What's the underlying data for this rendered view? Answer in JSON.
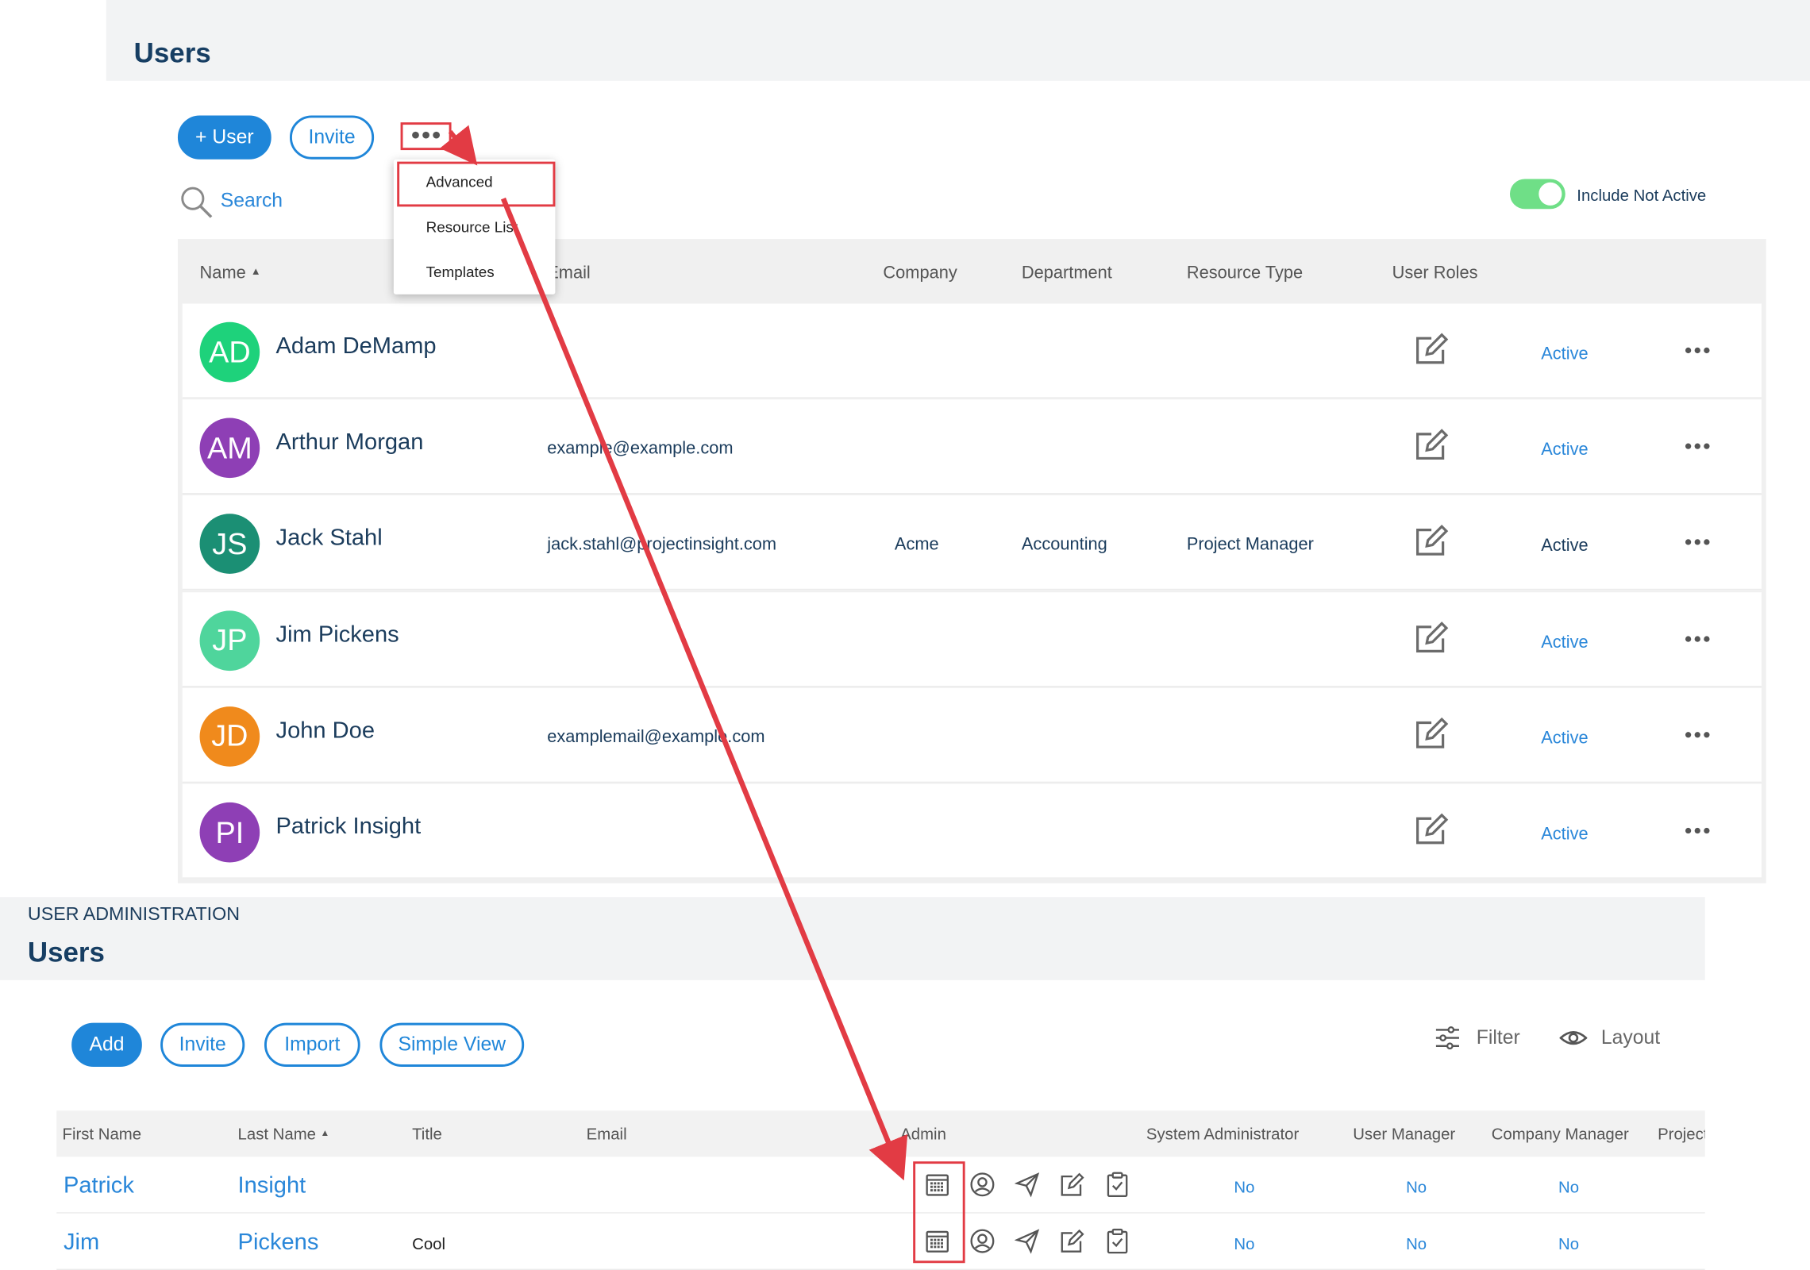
{
  "top": {
    "title": "Users",
    "add_user_label": "+ User",
    "invite_label": "Invite",
    "search_label": "Search",
    "include_not_active_label": "Include Not Active",
    "include_not_active_on": true,
    "menu_items": [
      "Advanced",
      "Resource List",
      "Templates"
    ],
    "columns": [
      "Name",
      "Email",
      "Company",
      "Department",
      "Resource Type",
      "User Roles"
    ],
    "rows": [
      {
        "initials": "AD",
        "name": "Adam DeMamp",
        "email": "",
        "company": "",
        "department": "",
        "resource_type": "",
        "status": "Active",
        "color": "#1ed27b"
      },
      {
        "initials": "AM",
        "name": "Arthur Morgan",
        "email": "example@example.com",
        "company": "",
        "department": "",
        "resource_type": "",
        "status": "Active",
        "color": "#8e3fb5"
      },
      {
        "initials": "JS",
        "name": "Jack Stahl",
        "email": "jack.stahl@projectinsight.com",
        "company": "Acme",
        "department": "Accounting",
        "resource_type": "Project Manager",
        "status": "Active",
        "color": "#1b8f74"
      },
      {
        "initials": "JP",
        "name": "Jim Pickens",
        "email": "",
        "company": "",
        "department": "",
        "resource_type": "",
        "status": "Active",
        "color": "#4fd59c"
      },
      {
        "initials": "JD",
        "name": "John Doe",
        "email": "examplemail@example.com",
        "company": "",
        "department": "",
        "resource_type": "",
        "status": "Active",
        "color": "#f08a1c"
      },
      {
        "initials": "PI",
        "name": "Patrick Insight",
        "email": "",
        "company": "",
        "department": "",
        "resource_type": "",
        "status": "Active",
        "color": "#8e3fb5"
      }
    ]
  },
  "bottom": {
    "breadcrumb": "USER ADMINISTRATION",
    "title": "Users",
    "buttons": [
      "Add",
      "Invite",
      "Import",
      "Simple View"
    ],
    "filter_label": "Filter",
    "layout_label": "Layout",
    "columns": [
      "First Name",
      "Last Name",
      "Title",
      "Email",
      "Admin",
      "System Administrator",
      "User Manager",
      "Company Manager",
      "Project"
    ],
    "rows": [
      {
        "first": "Patrick",
        "last": "Insight",
        "title": "",
        "email": "",
        "sys_admin": "No",
        "user_manager": "No",
        "company_manager": "No"
      },
      {
        "first": "Jim",
        "last": "Pickens",
        "title": "Cool",
        "email": "",
        "sys_admin": "No",
        "user_manager": "No",
        "company_manager": "No"
      }
    ]
  },
  "annotation": {
    "color": "#e23b44",
    "arrow": "from more-options to Advanced, then Advanced to Admin icons"
  }
}
